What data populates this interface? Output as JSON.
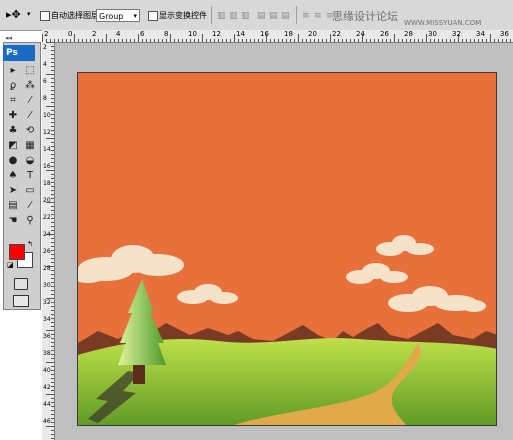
{
  "options_bar": {
    "auto_select_label": "自动选择图层",
    "group_value": "Group",
    "show_transform_label": "显示变换控件"
  },
  "ruler": {
    "top_numbers": [
      "2",
      "0",
      "2",
      "4",
      "6",
      "8",
      "10",
      "12",
      "14",
      "16",
      "18",
      "20",
      "22",
      "24",
      "26",
      "28",
      "30",
      "32",
      "34",
      "36"
    ],
    "left_numbers": [
      "2",
      "4",
      "6",
      "8",
      "10",
      "12",
      "14",
      "16",
      "18",
      "20",
      "22",
      "24",
      "26",
      "28",
      "30",
      "32",
      "34",
      "36",
      "38",
      "40",
      "42",
      "44",
      "46"
    ]
  },
  "toolbox": {
    "logo": "Ps",
    "icons": [
      "move-tool",
      "marquee-tool",
      "lasso-tool",
      "magic-wand-tool",
      "crop-tool",
      "eyedropper-tool",
      "healing-tool",
      "brush-tool",
      "stamp-tool",
      "history-brush-tool",
      "eraser-tool",
      "gradient-tool",
      "blur-tool",
      "dodge-tool",
      "pen-tool",
      "type-tool",
      "path-select-tool",
      "shape-tool",
      "notes-tool",
      "eyedropper-tool-2",
      "hand-tool",
      "zoom-tool"
    ],
    "foreground_color": "#ff0000",
    "background_color": "#ffffff"
  },
  "watermark": {
    "title": "思缘设计论坛",
    "url": "WWW.MISSYUAN.COM"
  },
  "canvas": {
    "sky_color": "#e8703a",
    "hill_color": "#9cc73a",
    "path_color": "#e1a94a",
    "mountain_color": "#7a3b24"
  }
}
